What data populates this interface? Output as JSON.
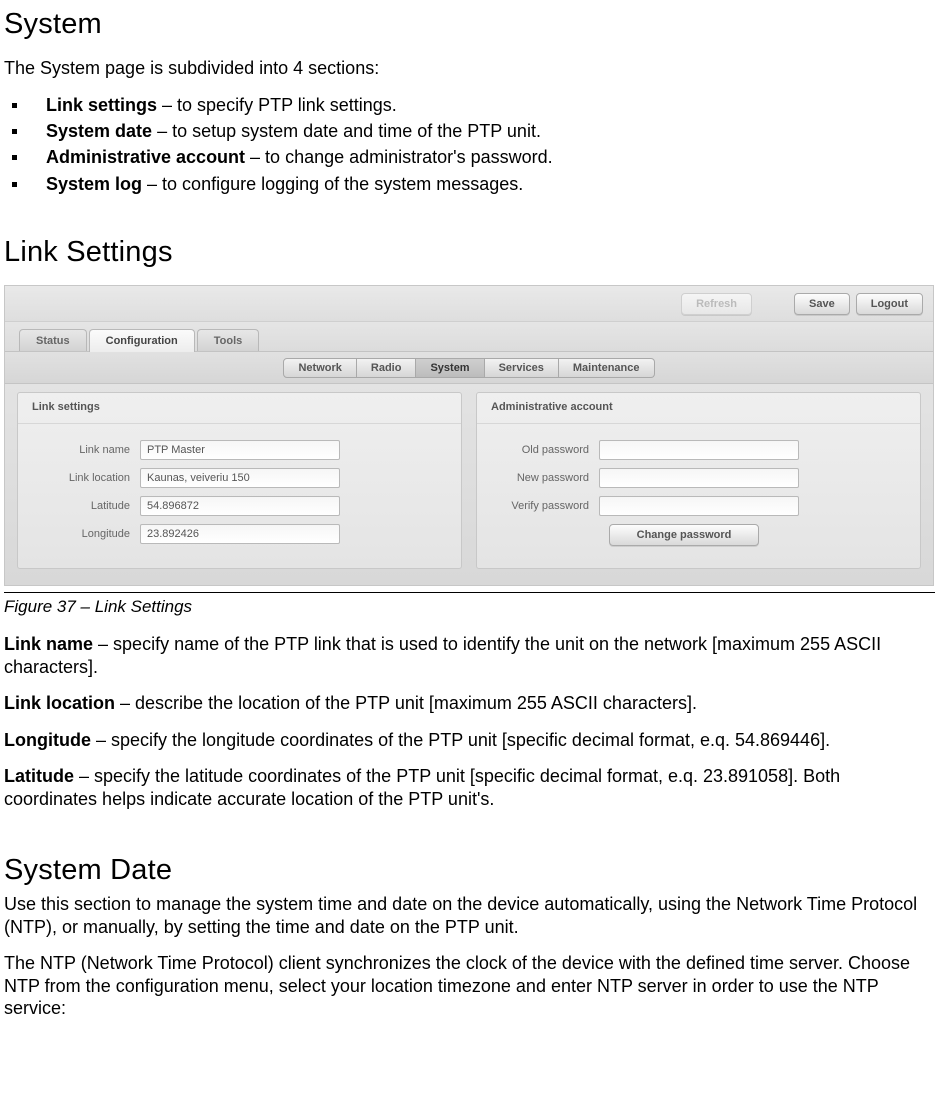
{
  "headings": {
    "system": "System",
    "link_settings": "Link Settings",
    "system_date": "System Date"
  },
  "intro": "The System page is subdivided into 4 sections:",
  "sections": [
    {
      "name": "Link settings",
      "desc": " – to specify PTP link settings."
    },
    {
      "name": "System date",
      "desc": " – to setup system date and time of the PTP unit."
    },
    {
      "name": "Administrative account",
      "desc": " – to change administrator's password."
    },
    {
      "name": "System log",
      "desc": " – to configure logging of the system messages."
    }
  ],
  "figure_caption": "Figure 37 – Link Settings",
  "defs": {
    "link_name": {
      "term": "Link name",
      "text": " – specify name of the PTP link that is used to identify the unit on the network [maximum 255 ASCII characters]."
    },
    "link_location": {
      "term": "Link location",
      "text": " – describe the location of the PTP unit [maximum 255 ASCII characters]."
    },
    "longitude": {
      "term": "Longitude",
      "text": " – specify the longitude coordinates of the PTP unit [specific decimal format, e.q. 54.869446]."
    },
    "latitude": {
      "term": "Latitude",
      "text": " – specify the latitude coordinates of the PTP unit [specific decimal format, e.q. 23.891058]. Both coordinates helps indicate accurate location of the PTP unit's."
    }
  },
  "system_date_p1": "Use this section to manage the system time and date on the device automatically, using the Network Time Protocol (NTP), or manually, by setting the time and date on the PTP unit.",
  "system_date_p2": "The NTP (Network Time Protocol) client synchronizes the clock of the device with the defined time server. Choose NTP from the configuration menu, select your location timezone and enter NTP server in order to use the NTP service:",
  "ui": {
    "topbar": {
      "refresh": "Refresh",
      "save": "Save",
      "logout": "Logout"
    },
    "tabs1": {
      "status": "Status",
      "configuration": "Configuration",
      "tools": "Tools"
    },
    "tabs2": {
      "network": "Network",
      "radio": "Radio",
      "system": "System",
      "services": "Services",
      "maintenance": "Maintenance"
    },
    "panel_link": {
      "title": "Link settings",
      "link_name_label": "Link name",
      "link_name_value": "PTP Master",
      "link_location_label": "Link location",
      "link_location_value": "Kaunas, veiveriu 150",
      "latitude_label": "Latitude",
      "latitude_value": "54.896872",
      "longitude_label": "Longitude",
      "longitude_value": "23.892426"
    },
    "panel_admin": {
      "title": "Administrative account",
      "old_label": "Old password",
      "new_label": "New password",
      "verify_label": "Verify password",
      "change_btn": "Change password"
    }
  }
}
